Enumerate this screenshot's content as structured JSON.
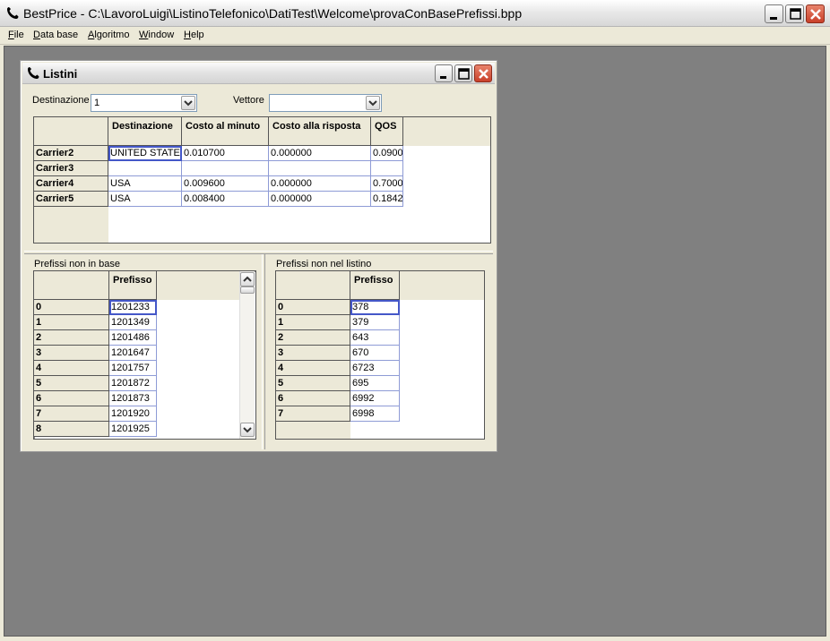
{
  "app": {
    "title": "BestPrice - C:\\LavoroLuigi\\ListinoTelefonico\\DatiTest\\Welcome\\provaConBasePrefissi.bpp"
  },
  "menu": [
    {
      "hotkey": "F",
      "rest": "ile"
    },
    {
      "hotkey": "D",
      "rest": "ata base"
    },
    {
      "hotkey": "A",
      "rest": "lgoritmo"
    },
    {
      "hotkey": "W",
      "rest": "indow"
    },
    {
      "hotkey": "H",
      "rest": "elp"
    }
  ],
  "listini": {
    "title": "Listini",
    "destinazione_label": "Destinazione",
    "destinazione_value": "1",
    "vettore_label": "Vettore",
    "vettore_value": "",
    "columns": [
      "Destinazione",
      "Costo al minuto",
      "Costo alla risposta",
      "QOS"
    ],
    "rows": [
      {
        "carrier": "Carrier2",
        "cells": [
          "UNITED STATES",
          "0.010700",
          "0.000000",
          "0.0900"
        ]
      },
      {
        "carrier": "Carrier3",
        "cells": [
          "",
          "",
          "",
          ""
        ]
      },
      {
        "carrier": "Carrier4",
        "cells": [
          "USA",
          "0.009600",
          "0.000000",
          "0.7000"
        ]
      },
      {
        "carrier": "Carrier5",
        "cells": [
          "USA",
          "0.008400",
          "0.000000",
          "0.1842"
        ]
      }
    ]
  },
  "prefissi_non_in_base": {
    "title": "Prefissi non in base",
    "column": "Prefisso",
    "rows": [
      {
        "idx": "0",
        "value": "1201233"
      },
      {
        "idx": "1",
        "value": "1201349"
      },
      {
        "idx": "2",
        "value": "1201486"
      },
      {
        "idx": "3",
        "value": "1201647"
      },
      {
        "idx": "4",
        "value": "1201757"
      },
      {
        "idx": "5",
        "value": "1201872"
      },
      {
        "idx": "6",
        "value": "1201873"
      },
      {
        "idx": "7",
        "value": "1201920"
      },
      {
        "idx": "8",
        "value": "1201925"
      }
    ]
  },
  "prefissi_non_nel_listino": {
    "title": "Prefissi non nel listino",
    "column": "Prefisso",
    "rows": [
      {
        "idx": "0",
        "value": "378"
      },
      {
        "idx": "1",
        "value": "379"
      },
      {
        "idx": "2",
        "value": "643"
      },
      {
        "idx": "3",
        "value": "670"
      },
      {
        "idx": "4",
        "value": "6723"
      },
      {
        "idx": "5",
        "value": "695"
      },
      {
        "idx": "6",
        "value": "6992"
      },
      {
        "idx": "7",
        "value": "6998"
      }
    ]
  },
  "colors": {
    "mdi_background": "#808080",
    "selection_border": "#4457c8",
    "close_button": "#c9402a"
  }
}
